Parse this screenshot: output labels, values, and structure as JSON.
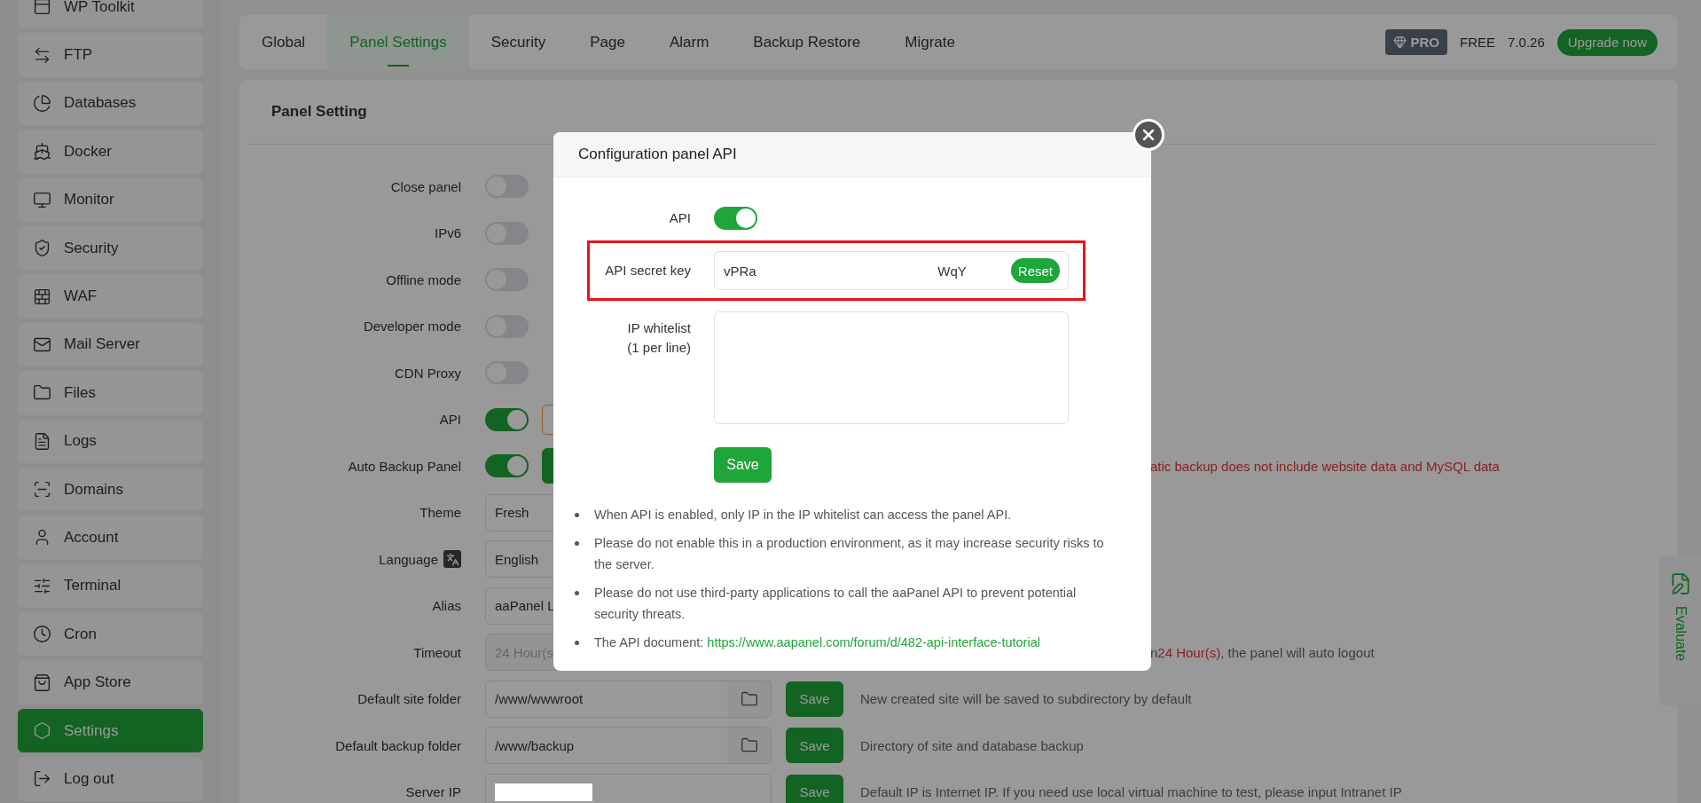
{
  "sidebar": {
    "items": [
      {
        "label": "WP Toolkit",
        "selected": false
      },
      {
        "label": "FTP",
        "selected": false
      },
      {
        "label": "Databases",
        "selected": false
      },
      {
        "label": "Docker",
        "selected": false
      },
      {
        "label": "Monitor",
        "selected": false
      },
      {
        "label": "Security",
        "selected": false
      },
      {
        "label": "WAF",
        "selected": false
      },
      {
        "label": "Mail Server",
        "selected": false
      },
      {
        "label": "Files",
        "selected": false
      },
      {
        "label": "Logs",
        "selected": false
      },
      {
        "label": "Domains",
        "selected": false
      },
      {
        "label": "Account",
        "selected": false
      },
      {
        "label": "Terminal",
        "selected": false
      },
      {
        "label": "Cron",
        "selected": false
      },
      {
        "label": "App Store",
        "selected": false
      },
      {
        "label": "Settings",
        "selected": true
      },
      {
        "label": "Log out",
        "selected": false
      }
    ]
  },
  "tabs": [
    {
      "label": "Global",
      "selected": false
    },
    {
      "label": "Panel Settings",
      "selected": true
    },
    {
      "label": "Security",
      "selected": false
    },
    {
      "label": "Page",
      "selected": false
    },
    {
      "label": "Alarm",
      "selected": false
    },
    {
      "label": "Backup Restore",
      "selected": false
    },
    {
      "label": "Migrate",
      "selected": false
    }
  ],
  "edition": {
    "badge": "PRO",
    "plan": "FREE",
    "version": "7.0.26",
    "upgrade_button": "Upgrade now"
  },
  "panel": {
    "title": "Panel Setting",
    "rows": [
      {
        "label": "Close panel",
        "kind": "toggle",
        "on": false
      },
      {
        "label": "IPv6",
        "kind": "toggle",
        "on": false
      },
      {
        "label": "Offline mode",
        "kind": "toggle",
        "on": false
      },
      {
        "label": "Developer mode",
        "kind": "toggle",
        "on": false
      },
      {
        "label": "CDN Proxy",
        "kind": "toggle",
        "on": false
      },
      {
        "label": "API",
        "kind": "toggle-button",
        "on": true,
        "button_outline": true
      },
      {
        "label": "Auto Backup Panel",
        "kind": "toggle-button",
        "on": true,
        "button_outline": false,
        "note": {
          "covered": true,
          "parts": [
            {
              "text": "atic backup does not include website data and MySQL data",
              "warning": true
            }
          ]
        }
      },
      {
        "label": "Theme",
        "kind": "select",
        "value": "Fresh"
      },
      {
        "label": "Language",
        "kind": "select",
        "value": "English",
        "with_icon": true
      },
      {
        "label": "Alias",
        "kind": "input",
        "value": "aaPanel L",
        "disabled": false
      },
      {
        "label": "Timeout",
        "kind": "input",
        "placeholder": "24 Hour(s",
        "disabled": true,
        "note": {
          "covered": true,
          "parts": [
            {
              "text": "n",
              "warning": false
            },
            {
              "text": "24 Hour(s)",
              "warning": true
            },
            {
              "text": ", the panel will auto logout",
              "warning": false
            }
          ]
        }
      },
      {
        "label": "Default site folder",
        "kind": "folder",
        "value": "/www/wwwroot",
        "button": "Save",
        "note": {
          "parts": [
            {
              "text": "New created site will be saved to subdirectory by default",
              "warning": false
            }
          ]
        }
      },
      {
        "label": "Default backup folder",
        "kind": "folder",
        "value": "/www/backup",
        "button": "Save",
        "note": {
          "parts": [
            {
              "text": "Directory of site and database backup",
              "warning": false
            }
          ]
        }
      },
      {
        "label": "Server IP",
        "kind": "redacted",
        "button": "Save",
        "note": {
          "parts": [
            {
              "text": "Default IP is Internet IP. If you need use local virtual machine to test, please input Intranet IP",
              "warning": false
            }
          ]
        }
      }
    ]
  },
  "dialog": {
    "title": "Configuration panel API",
    "rows": [
      {
        "label": "API",
        "kind": "toggle",
        "on": true,
        "highlighted": false
      },
      {
        "label": "API secret key",
        "kind": "secret",
        "value_start": "vPRa",
        "value_end": "WqY",
        "button": "Reset",
        "highlighted": true
      },
      {
        "label": "IP whitelist\n(1 per line)",
        "kind": "textarea",
        "highlighted": false
      }
    ],
    "save_button": "Save",
    "notes": [
      {
        "text": "When API is enabled, only IP in the IP whitelist can access the panel API."
      },
      {
        "text": "Please do not enable this in a production environment, as it may increase security risks to the server."
      },
      {
        "text": "Please do not use third-party applications to call the aaPanel API to prevent potential security threats."
      },
      {
        "text": "The API document: ",
        "link": "https://www.aapanel.com/forum/d/482-api-interface-tutorial"
      }
    ]
  },
  "evaluate": {
    "label": "Evaluate"
  }
}
